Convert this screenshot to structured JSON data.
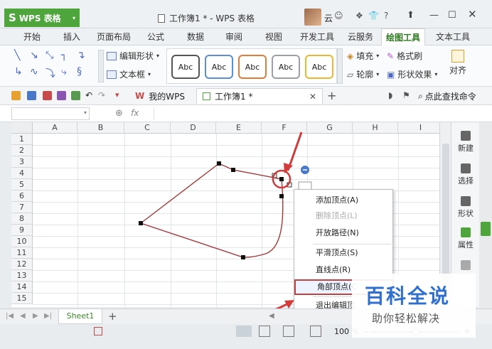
{
  "app": {
    "name": "WPS 表格",
    "logo": "S"
  },
  "window": {
    "title": "工作簿1 * - WPS 表格",
    "cloud_label": "云",
    "help_label": "?"
  },
  "tabs": [
    "开始",
    "插入",
    "页面布局",
    "公式",
    "数据",
    "审阅",
    "视图",
    "开发工具",
    "云服务",
    "绘图工具",
    "文本工具"
  ],
  "active_tab": "绘图工具",
  "ribbon": {
    "edit_shape": "编辑形状",
    "text_box": "文本框",
    "style_boxes": [
      "Abc",
      "Abc",
      "Abc",
      "Abc",
      "Abc"
    ],
    "style_colors": [
      "#555555",
      "#5b8fd4",
      "#e07b39",
      "#9aa0a6",
      "#e8b830"
    ],
    "fill": "填充",
    "format_brush": "格式刷",
    "outline": "轮廓",
    "shape_effects": "形状效果",
    "align": "对齐"
  },
  "doc_tabs": {
    "wps_tab": "我的WPS",
    "book_tab": "工作簿1 *",
    "search": "点此查找命令"
  },
  "formula_bar": {
    "fx": "fx"
  },
  "columns": [
    "A",
    "B",
    "C",
    "D",
    "E",
    "F",
    "G",
    "H",
    "I"
  ],
  "rows": [
    "1",
    "2",
    "3",
    "4",
    "5",
    "6",
    "7",
    "8",
    "9",
    "10",
    "11",
    "12",
    "13",
    "14",
    "15"
  ],
  "right_panel": [
    "新建",
    "选择",
    "形状",
    "属性"
  ],
  "context_menu": {
    "items": [
      {
        "label": "添加顶点(A)",
        "state": "normal"
      },
      {
        "label": "删除顶点(L)",
        "state": "disabled"
      },
      {
        "label": "开放路径(N)",
        "state": "normal"
      },
      {
        "label": "平滑顶点(S)",
        "state": "normal"
      },
      {
        "label": "直线点(R)",
        "state": "normal"
      },
      {
        "label": "角部顶点(C",
        "state": "highlight"
      },
      {
        "label": "退出编辑顶",
        "state": "normal"
      }
    ]
  },
  "sheet_tabs": {
    "sheet1": "Sheet1"
  },
  "status": {
    "zoom": "100 %"
  },
  "watermark": {
    "title": "百科全说",
    "subtitle": "助你轻松解决"
  },
  "colors": {
    "accent_green": "#4ea53c",
    "annotation_red": "#d33b3b",
    "shape_line": "#a33a3a"
  }
}
